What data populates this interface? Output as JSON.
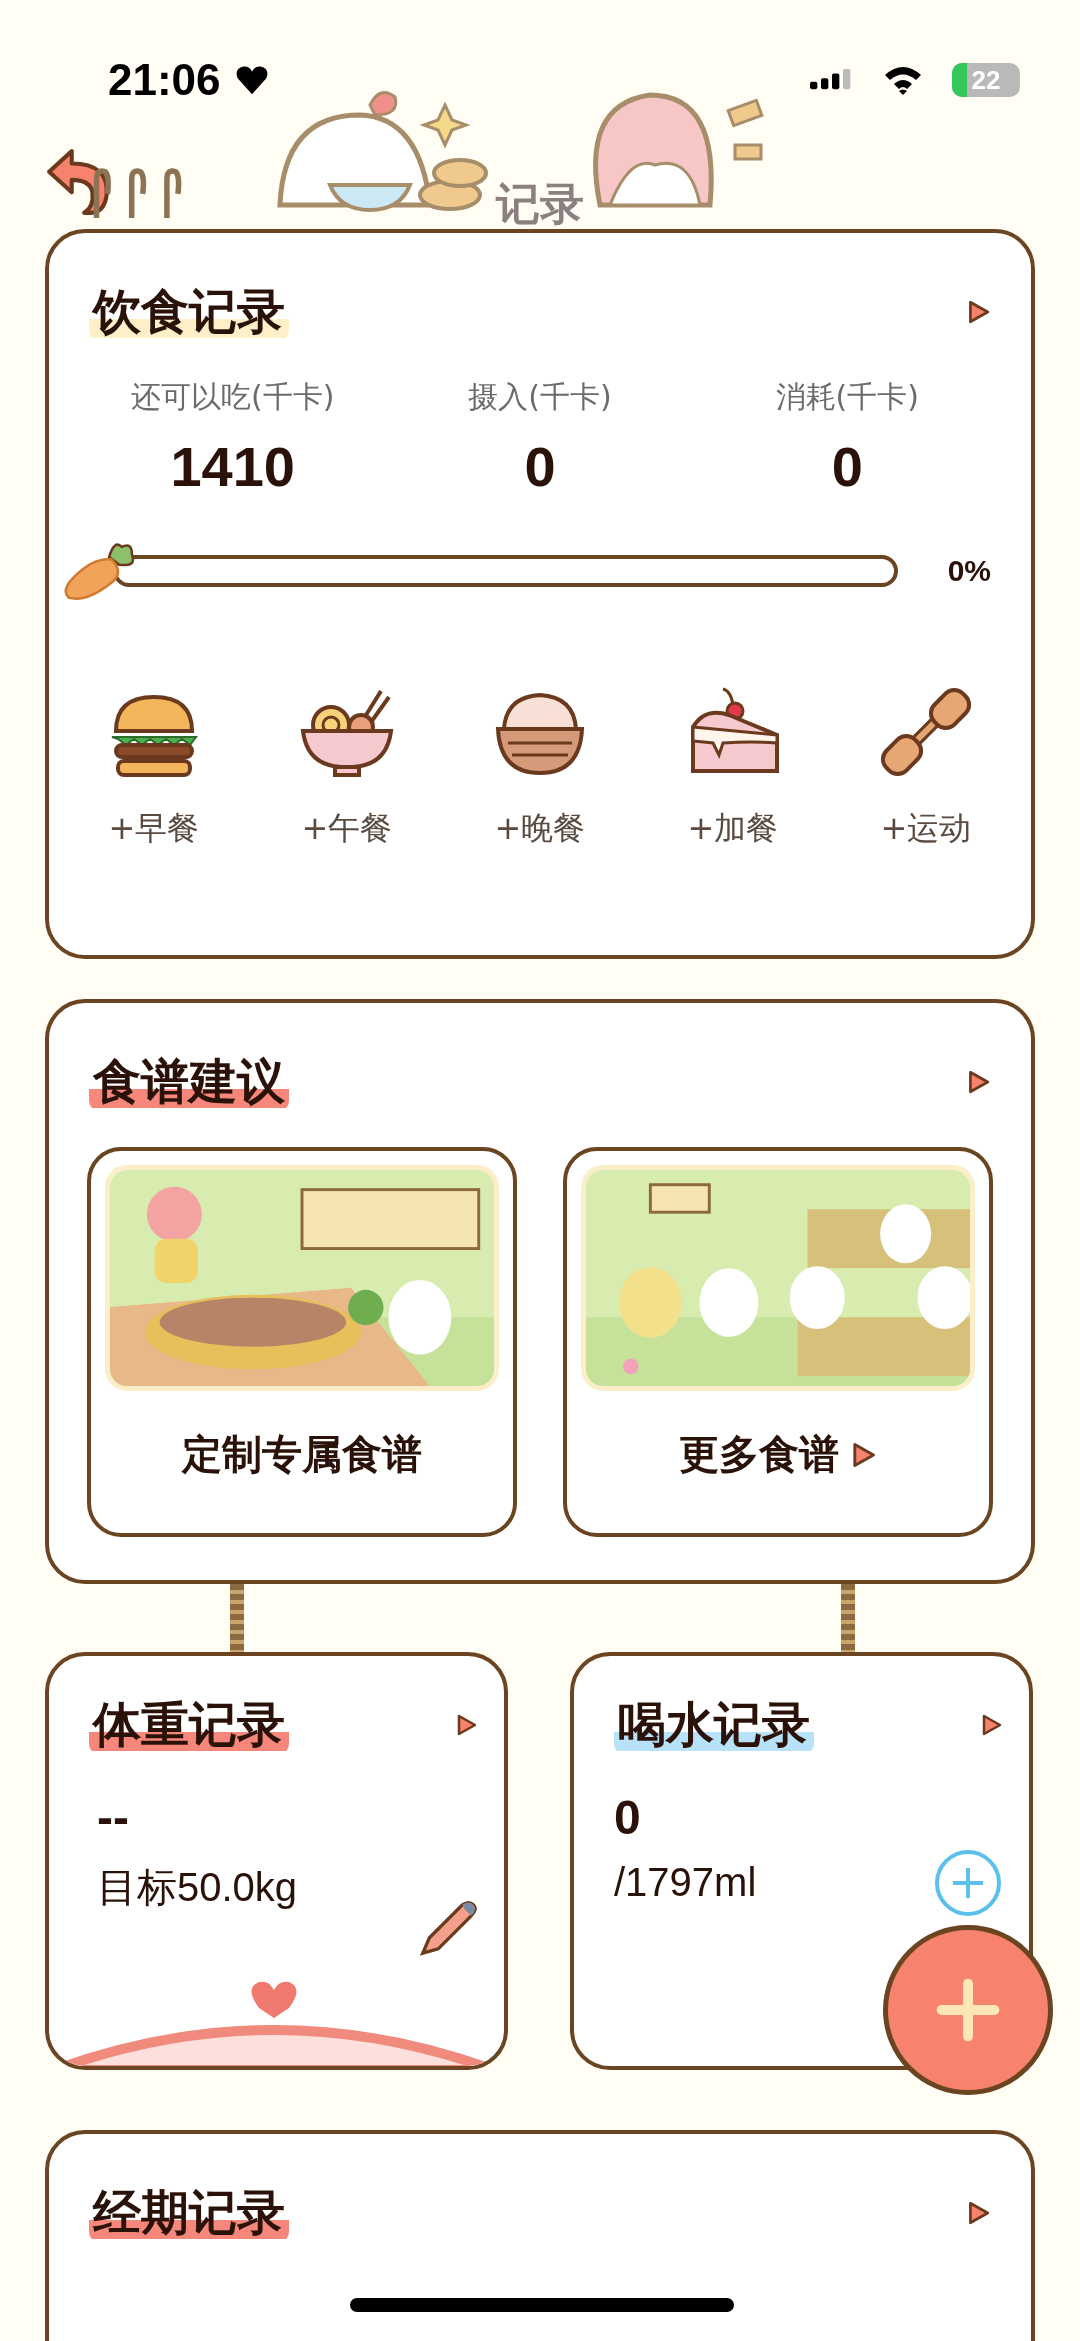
{
  "status_bar": {
    "time": "21:06",
    "battery": "22"
  },
  "header": {
    "title": "记录"
  },
  "diet": {
    "title": "饮食记录",
    "stats": [
      {
        "label": "还可以吃(千卡)",
        "value": "1410"
      },
      {
        "label": "摄入(千卡)",
        "value": "0"
      },
      {
        "label": "消耗(千卡)",
        "value": "0"
      }
    ],
    "progress": {
      "level": 0,
      "reading": "0%"
    },
    "meals": [
      {
        "kind": "burger",
        "label": "+早餐"
      },
      {
        "kind": "noodles",
        "label": "+午餐"
      },
      {
        "kind": "rice",
        "label": "+晚餐"
      },
      {
        "kind": "cake",
        "label": "+加餐"
      },
      {
        "kind": "dumbbell",
        "label": "+运动"
      }
    ]
  },
  "recipes": {
    "title": "食谱建议",
    "cards": [
      {
        "label": "定制专属食谱",
        "arrow": false,
        "kind": "picture"
      },
      {
        "label": "更多食谱",
        "arrow": true,
        "kind": "picture"
      }
    ]
  },
  "weight": {
    "title": "体重记录",
    "value": "--",
    "target": "目标50.0kg"
  },
  "water": {
    "title": "喝水记录",
    "value": "0",
    "goal": "/1797ml"
  },
  "period": {
    "title": "经期记录"
  }
}
